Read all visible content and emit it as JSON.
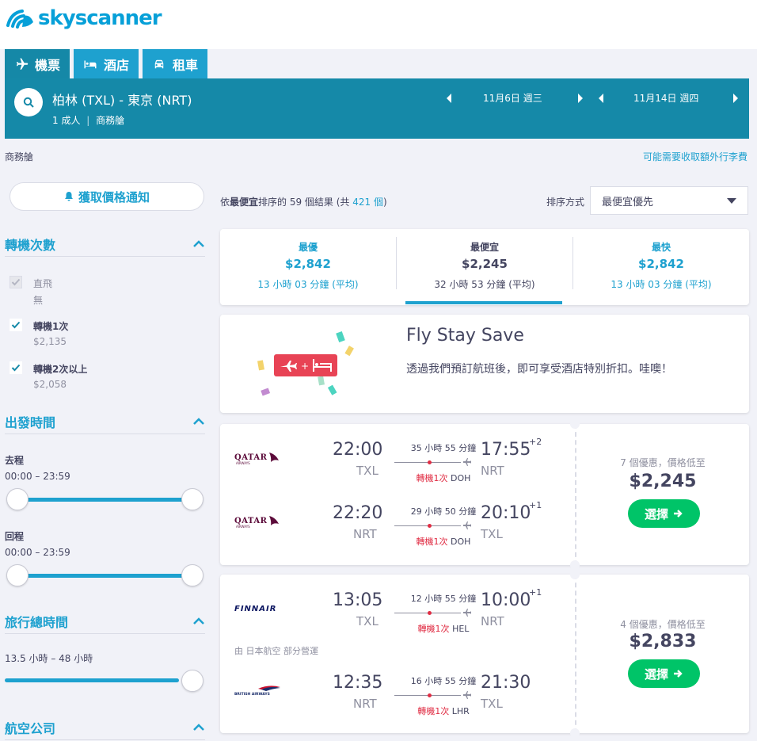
{
  "brand": {
    "name": "skyscanner"
  },
  "tabs": [
    {
      "label": "機票",
      "icon": "plane-icon"
    },
    {
      "label": "酒店",
      "icon": "bed-icon"
    },
    {
      "label": "租車",
      "icon": "car-icon"
    }
  ],
  "search": {
    "route": "柏林 (TXL) - 東京 (NRT)",
    "passengers": "1 成人",
    "cabin": "商務艙",
    "depart_date": "11月6日 週三",
    "return_date": "11月14日 週四"
  },
  "subheader": {
    "cabin_note": "商務艙",
    "fee_link": "可能需要收取額外行李費"
  },
  "sidebar": {
    "alert_button": "獲取價格通知",
    "stops": {
      "title": "轉機次數",
      "options": [
        {
          "label": "直飛",
          "sub": "無"
        },
        {
          "label": "轉機1次",
          "sub": "$2,135"
        },
        {
          "label": "轉機2次以上",
          "sub": "$2,058"
        }
      ]
    },
    "departure_times": {
      "title": "出發時間",
      "outbound_label": "去程",
      "outbound_range": "00:00 – 23:59",
      "return_label": "回程",
      "return_range": "00:00 – 23:59"
    },
    "duration": {
      "title": "旅行總時間",
      "range": "13.5 小時 – 48 小時"
    },
    "airlines": {
      "title": "航空公司"
    }
  },
  "results": {
    "prefix": "依",
    "sort_word": "最便宜",
    "middle": "排序的 59 個結果 (共 ",
    "total": "421 個",
    "suffix": ")"
  },
  "sort": {
    "label": "排序方式",
    "selected": "最便宜優先",
    "tabs": [
      {
        "title": "最優",
        "price": "$2,842",
        "duration": "13 小時 03 分鐘 (平均)"
      },
      {
        "title": "最便宜",
        "price": "$2,245",
        "duration": "32 小時 53 分鐘 (平均)"
      },
      {
        "title": "最快",
        "price": "$2,842",
        "duration": "13 小時 03 分鐘 (平均)"
      }
    ]
  },
  "promo": {
    "title": "Fly Stay Save",
    "text": "透過我們預訂航班後，即可享受酒店特別折扣。哇噢！"
  },
  "itineraries": [
    {
      "deals": "7 個優惠，價格低至",
      "price": "$2,245",
      "select_label": "選擇",
      "operated_by": "",
      "legs": [
        {
          "airline": "QATAR",
          "dep_time": "22:00",
          "dep_code": "TXL",
          "duration": "35 小時 55 分鐘",
          "stops": "轉機1次",
          "via": "DOH",
          "arr_time": "17:55",
          "arr_code": "NRT",
          "day_offset": "+2"
        },
        {
          "airline": "QATAR",
          "dep_time": "22:20",
          "dep_code": "NRT",
          "duration": "29 小時 50 分鐘",
          "stops": "轉機1次",
          "via": "DOH",
          "arr_time": "20:10",
          "arr_code": "TXL",
          "day_offset": "+1"
        }
      ]
    },
    {
      "deals": "4 個優惠，價格低至",
      "price": "$2,833",
      "select_label": "選擇",
      "operated_by": "由 日本航空 部分營運",
      "legs": [
        {
          "airline": "FINNAIR",
          "dep_time": "13:05",
          "dep_code": "TXL",
          "duration": "12 小時 55 分鐘",
          "stops": "轉機1次",
          "via": "HEL",
          "arr_time": "10:00",
          "arr_code": "NRT",
          "day_offset": "+1"
        },
        {
          "airline": "BRITISH AIRWAYS",
          "dep_time": "12:35",
          "dep_code": "NRT",
          "duration": "16 小時 55 分鐘",
          "stops": "轉機1次",
          "via": "LHR",
          "arr_time": "21:30",
          "arr_code": "TXL",
          "day_offset": ""
        }
      ]
    }
  ],
  "colors": {
    "brand": "#07a0d8",
    "search_bar": "#1589a8",
    "accent": "#1ea1cf",
    "select_button": "#00c468",
    "stop_red": "#e02c43"
  }
}
